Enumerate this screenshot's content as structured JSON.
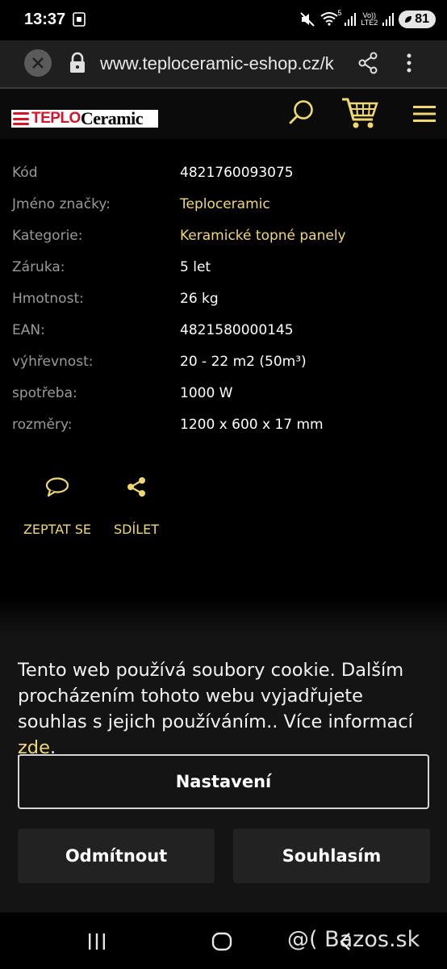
{
  "status_bar": {
    "time": "13:37",
    "network_label": "LTE2",
    "network_volte": "Vo))",
    "wifi_badge": "5",
    "battery": "81",
    "icons": [
      "screenshot-icon",
      "mute-icon",
      "wifi-icon",
      "signal-icon",
      "signal-icon-2",
      "battery-icon"
    ]
  },
  "browser": {
    "url": "www.teploceramic-eshop.cz/k",
    "icons": [
      "close-icon",
      "lock-icon",
      "share-icon",
      "more-vert-icon"
    ]
  },
  "header": {
    "logo_part1": "TEPLO",
    "logo_part2": "Ceramic",
    "icons": [
      "search-icon",
      "cart-icon",
      "menu-icon"
    ],
    "accent_color": "#efd873",
    "brand_red": "#d3142b"
  },
  "specs": [
    {
      "label": "Kód",
      "value": "4821760093075"
    },
    {
      "label": "Jméno značky:",
      "value": "Teploceramic"
    },
    {
      "label": "Kategorie:",
      "value": "Keramické topné panely"
    },
    {
      "label": "Záruka:",
      "value": "5 let"
    },
    {
      "label": "Hmotnost:",
      "value": "26 kg"
    },
    {
      "label": "EAN:",
      "value": "4821580000145"
    },
    {
      "label": "výhřevnost:",
      "value": "20 - 22 m2 (50m³)"
    },
    {
      "label": "spotřeba:",
      "value": "1000 W"
    },
    {
      "label": "rozměry:",
      "value": "1200 x 600 x 17 mm"
    }
  ],
  "actions": {
    "ask_label": "ZEPTAT SE",
    "share_label": "SDÍLET"
  },
  "cookie": {
    "text": "Tento web používá soubory cookie. Dalším procházením tohoto webu vyjadřujete souhlas s jejich používáním.. Více informací ",
    "link": "zde",
    "after_link": ".",
    "settings_label": "Nastavení",
    "reject_label": "Odmítnout",
    "accept_label": "Souhlasím"
  },
  "nav": {
    "icons": [
      "recents-icon",
      "home-icon",
      "back-icon"
    ],
    "watermark": "@( Bazos.sk"
  }
}
